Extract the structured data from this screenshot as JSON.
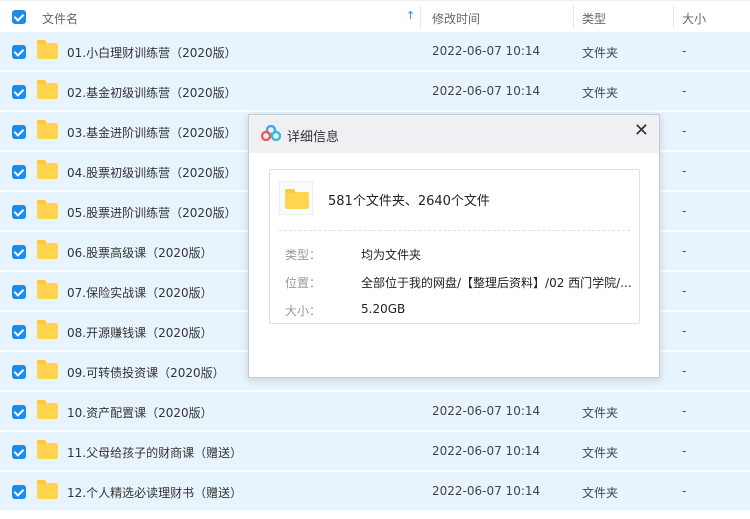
{
  "header": {
    "name": "文件名",
    "sort_icon": "arrow-up-icon",
    "modified": "修改时间",
    "type": "类型",
    "size": "大小"
  },
  "colors": {
    "accent": "#1a8cf0",
    "row_selected": "#e8f4fd",
    "folder": "#ffd44f"
  },
  "rows": [
    {
      "name": "01.小白理财训练营（2020版）",
      "date": "2022-06-07 10:14",
      "type": "文件夹",
      "size": "-"
    },
    {
      "name": "02.基金初级训练营（2020版）",
      "date": "2022-06-07 10:14",
      "type": "文件夹",
      "size": "-"
    },
    {
      "name": "03.基金进阶训练营（2020版）",
      "date": "",
      "type": "",
      "size": "-"
    },
    {
      "name": "04.股票初级训练营（2020版）",
      "date": "",
      "type": "",
      "size": "-"
    },
    {
      "name": "05.股票进阶训练营（2020版）",
      "date": "",
      "type": "",
      "size": "-"
    },
    {
      "name": "06.股票高级课（2020版）",
      "date": "",
      "type": "",
      "size": "-"
    },
    {
      "name": "07.保险实战课（2020版）",
      "date": "",
      "type": "",
      "size": "-"
    },
    {
      "name": "08.开源赚钱课（2020版）",
      "date": "",
      "type": "",
      "size": "-"
    },
    {
      "name": "09.可转债投资课（2020版）",
      "date": "",
      "type": "",
      "size": "-"
    },
    {
      "name": "10.资产配置课（2020版）",
      "date": "2022-06-07 10:14",
      "type": "文件夹",
      "size": "-"
    },
    {
      "name": "11.父母给孩子的财商课（赠送）",
      "date": "2022-06-07 10:14",
      "type": "文件夹",
      "size": "-"
    },
    {
      "name": "12.个人精选必读理财书（赠送）",
      "date": "2022-06-07 10:14",
      "type": "文件夹",
      "size": "-"
    }
  ],
  "dialog": {
    "title": "详细信息",
    "close": "✕",
    "summary": "581个文件夹、2640个文件",
    "type_label": "类型：",
    "type_value": "均为文件夹",
    "location_label": "位置：",
    "location_value": "全部位于我的网盘/【整理后资料】/02 西门学院/...",
    "size_label": "大小：",
    "size_value": "5.20GB"
  }
}
